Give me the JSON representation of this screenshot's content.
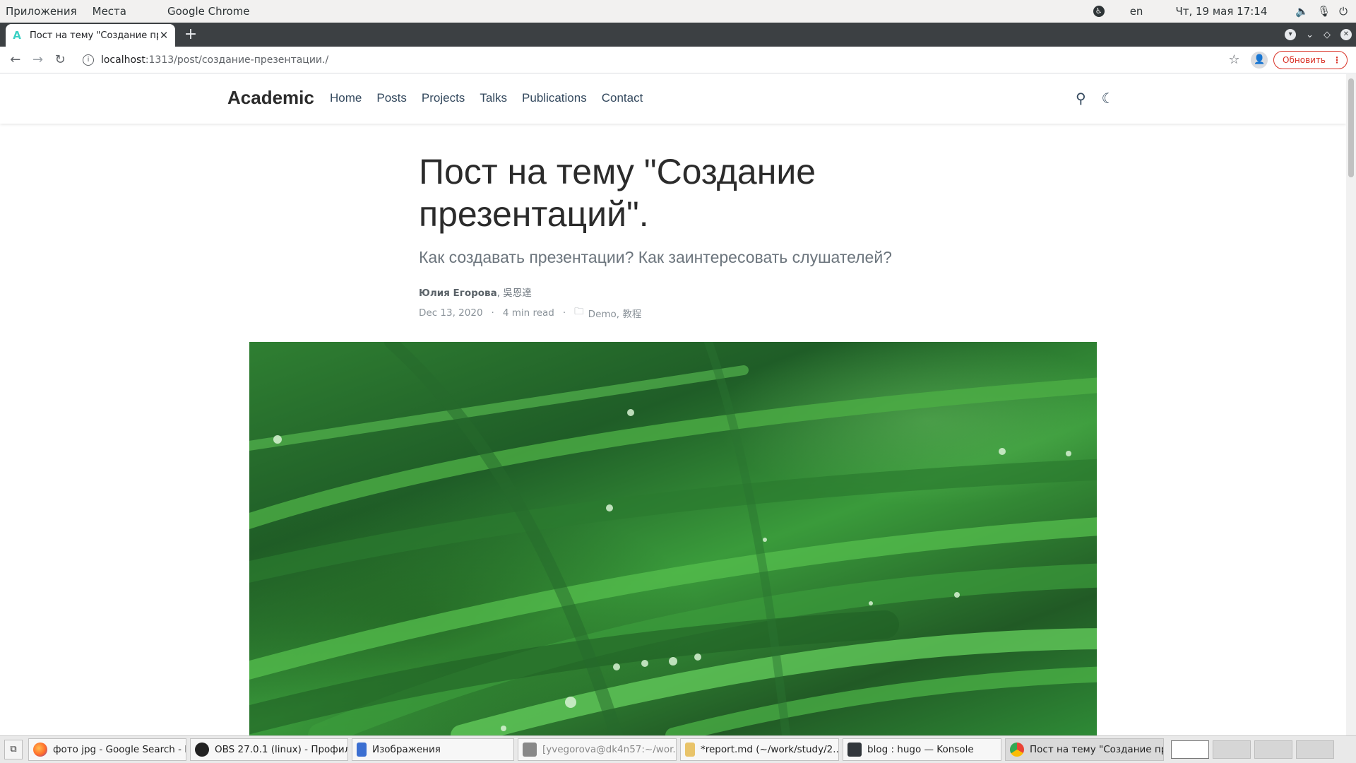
{
  "topbar": {
    "applications": "Приложения",
    "places": "Места",
    "active_app": "Google Chrome",
    "language": "en",
    "datetime": "Чт, 19 мая  17:14"
  },
  "browser": {
    "tab_title": "Пост на тему \"Создание пре",
    "url_host": "localhost",
    "url_path": ":1313/post/создание-презентации./",
    "update_label": "Обновить"
  },
  "site": {
    "brand": "Academic",
    "menu": [
      "Home",
      "Posts",
      "Projects",
      "Talks",
      "Publications",
      "Contact"
    ]
  },
  "post": {
    "title": "Пост на тему \"Создание презентаций\".",
    "subtitle": "Как создавать презентации? Как заинтересовать слушателей?",
    "author_main": "Юлия Егорова",
    "author_other": ", 吳恩達",
    "date": "Dec 13, 2020",
    "read_time": "4 min read",
    "categories": "Demo, 教程"
  },
  "taskbar": {
    "tasks": [
      "фото jpg - Google Search - M...",
      "OBS 27.0.1 (linux) - Профил...",
      "Изображения",
      "[yvegorova@dk4n57:~/wor...",
      "*report.md (~/work/study/2...",
      "blog : hugo — Konsole",
      "Пост на тему \"Создание пр..."
    ]
  },
  "colors": {
    "accent_update": "#d93025",
    "brand_text": "#2b2b2b",
    "favicon": "#3ad1c4"
  }
}
